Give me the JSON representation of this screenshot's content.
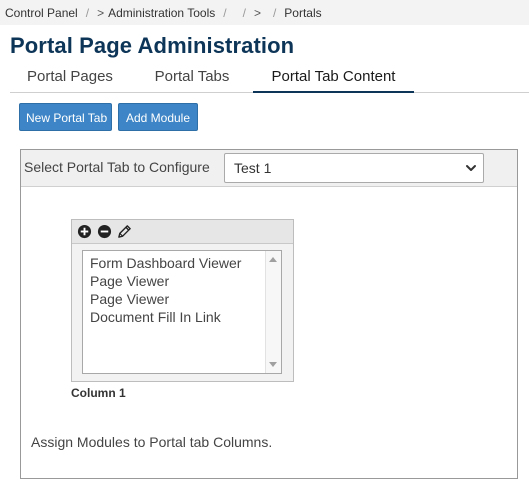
{
  "breadcrumb": {
    "items": [
      "Control Panel",
      "Administration Tools",
      "",
      "Portals"
    ],
    "chevron": ">"
  },
  "page": {
    "title": "Portal Page Administration"
  },
  "tabs": [
    {
      "label": "Portal Pages",
      "active": false
    },
    {
      "label": "Portal Tabs",
      "active": false
    },
    {
      "label": "Portal Tab Content",
      "active": true
    }
  ],
  "toolbar": {
    "new_portal_tab_label": "New Portal Tab",
    "add_module_label": "Add Module"
  },
  "config": {
    "select_label": "Select Portal Tab to Configure",
    "selected_tab": "Test 1"
  },
  "column": {
    "label": "Column 1",
    "modules": [
      "Form Dashboard Viewer",
      "Page Viewer",
      "Page Viewer",
      "Document Fill In Link"
    ],
    "toolbar_icons": [
      "plus-circle-icon",
      "minus-circle-icon",
      "pencil-icon"
    ]
  },
  "footer": {
    "hint": "Assign Modules to Portal tab Columns."
  },
  "colors": {
    "accent": "#3d85c6",
    "title": "#0d3557"
  }
}
